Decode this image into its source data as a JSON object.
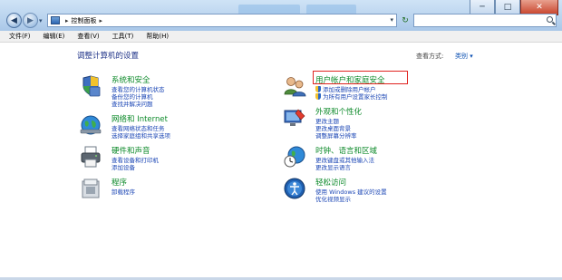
{
  "window": {
    "controls": [
      "─",
      "□",
      "✕"
    ]
  },
  "nav": {
    "back_glyph": "◀",
    "forward_glyph": "▶",
    "dropdown_glyph": "▾"
  },
  "address": {
    "separator": "▸",
    "path": "控制面板",
    "end_glyph": "▾"
  },
  "refresh_glyph": "↻",
  "search": {
    "placeholder": ""
  },
  "menu": [
    "文件(F)",
    "编辑(E)",
    "查看(V)",
    "工具(T)",
    "帮助(H)"
  ],
  "content": {
    "heading": "调整计算机的设置",
    "view_by_label": "查看方式:",
    "view_by_value": "类别 ▾"
  },
  "categories": [
    {
      "title": "系统和安全",
      "icon": "shield-flag-icon",
      "links": [
        "查看您的计算机状态",
        "备份您的计算机",
        "查找并解决问题"
      ]
    },
    {
      "title": "网络和 Internet",
      "icon": "network-globe-icon",
      "links": [
        "查看网络状态和任务",
        "选择家庭组和共享选项"
      ]
    },
    {
      "title": "硬件和声音",
      "icon": "printer-icon",
      "links": [
        "查看设备和打印机",
        "添加设备"
      ]
    },
    {
      "title": "程序",
      "icon": "programs-icon",
      "links": [
        "卸载程序"
      ]
    },
    {
      "title": "用户帐户和家庭安全",
      "icon": "users-icon",
      "links": [
        "添加或删除用户帐户",
        "为所有用户设置家长控制"
      ]
    },
    {
      "title": "外观和个性化",
      "icon": "display-paint-icon",
      "links": [
        "更改主题",
        "更改桌面背景",
        "调整屏幕分辨率"
      ]
    },
    {
      "title": "时钟、语言和区域",
      "icon": "clock-globe-icon",
      "links": [
        "更改键盘或其他输入法",
        "更改显示语言"
      ]
    },
    {
      "title": "轻松访问",
      "icon": "ease-of-access-icon",
      "links": [
        "使用 Windows 建议的设置",
        "优化视频显示"
      ]
    }
  ],
  "colors": {
    "category_title": "#0d8a2a",
    "link": "#1b46b5",
    "heading": "#1e3287",
    "highlight": "#e0231f"
  }
}
